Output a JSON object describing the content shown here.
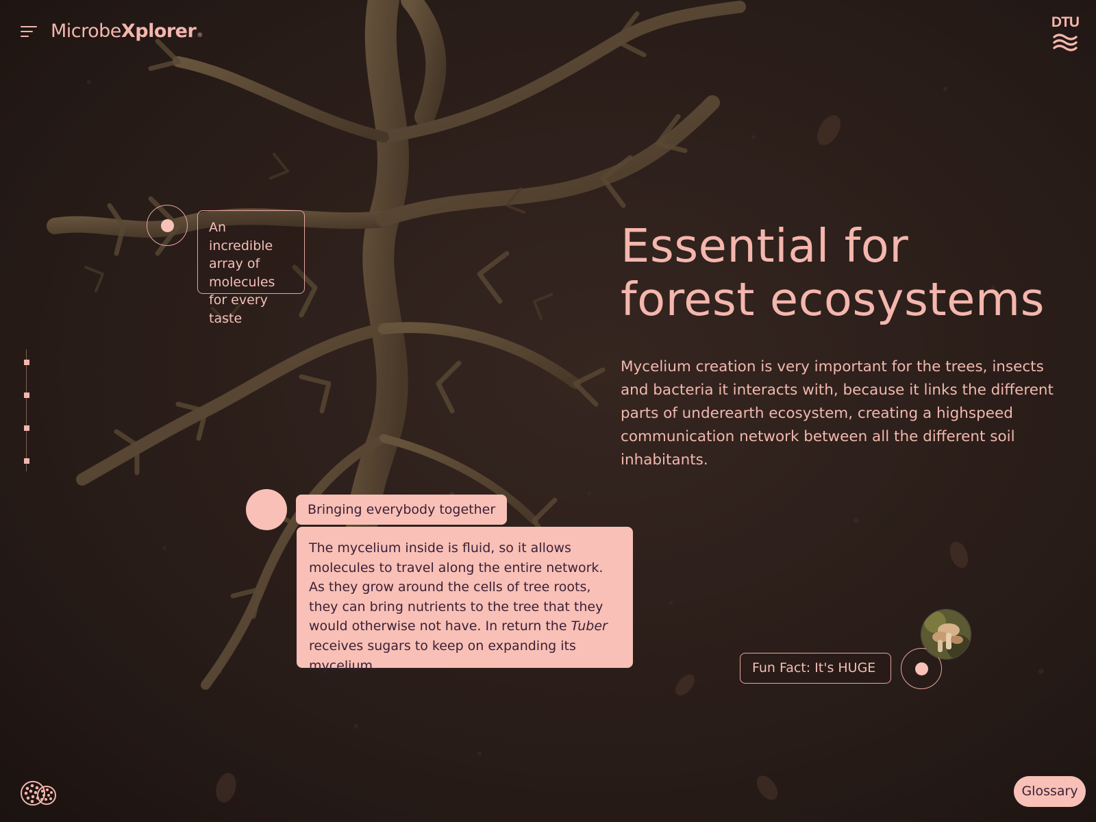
{
  "header": {
    "menu_icon": "hamburger-menu-icon",
    "logo": {
      "part1": "Microbe",
      "part2": "Xplorer",
      "registered": "®"
    },
    "partner_logo": {
      "text": "DTU",
      "icon": "dtu-wave-icon"
    }
  },
  "hotspots": {
    "molecules_label": "An incredible array of molecules for every taste",
    "fun_fact_label": "Fun Fact: It's HUGE"
  },
  "info_card": {
    "title": "Bringing everybody together",
    "text_before": "The mycelium inside is fluid, so it allows molecules to travel along the entire network. As they grow around the cells of tree roots, they can bring nutrients to the tree that they would otherwise not have. In return the ",
    "text_italic": "Tuber",
    "text_after": " receives sugars to keep on expanding its mycelium."
  },
  "main": {
    "headline_line1": "Essential for",
    "headline_line2": "forest ecosystems",
    "body": "Mycelium creation is very important for the trees, insects and bacteria it interacts with, because it links the different parts of underearth ecosystem, creating a highspeed communication network between all the different soil inhabitants."
  },
  "side_nav": {
    "steps": 4,
    "icon": "progress-step-icon"
  },
  "thumbnail": {
    "icon": "mushroom-photo-icon"
  },
  "bottom": {
    "truffle_icon": "truffle-icon",
    "glossary_label": "Glossary"
  },
  "colors": {
    "accent": "#f8c0b6",
    "text_dark": "#3a1f36",
    "soil_dark": "#2a1d18",
    "root": "#7a6446"
  }
}
